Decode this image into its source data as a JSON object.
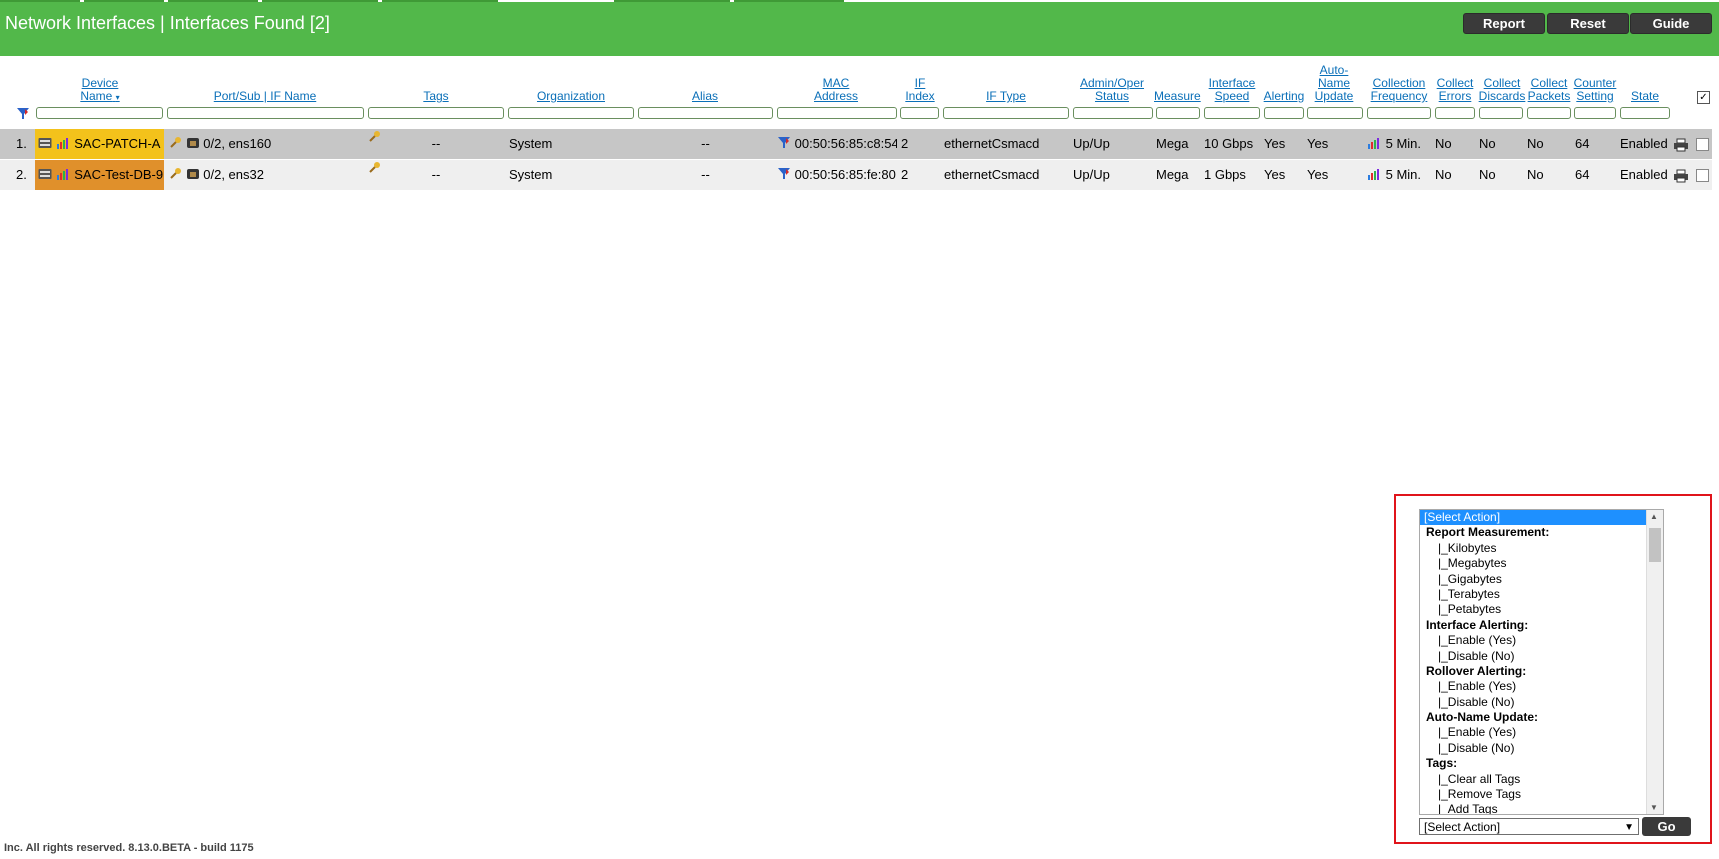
{
  "header": {
    "title": "Network Interfaces | Interfaces Found [2]",
    "buttons": {
      "report": "Report",
      "reset": "Reset",
      "guide": "Guide"
    }
  },
  "columns": {
    "device_name": [
      "Device",
      "Name"
    ],
    "port": "Port/Sub | IF Name",
    "tags": "Tags",
    "organization": "Organization",
    "alias": "Alias",
    "mac": [
      "MAC",
      "Address"
    ],
    "if_index": [
      "IF",
      "Index"
    ],
    "if_type": "IF Type",
    "admin_oper": [
      "Admin/Oper",
      "Status"
    ],
    "measure": "Measure",
    "speed": [
      "Interface",
      "Speed"
    ],
    "alerting": "Alerting",
    "auto_name": [
      "Auto-",
      "Name",
      "Update"
    ],
    "collection": [
      "Collection",
      "Frequency"
    ],
    "errors": [
      "Collect",
      "Errors"
    ],
    "discards": [
      "Collect",
      "Discards"
    ],
    "packets": [
      "Collect",
      "Packets"
    ],
    "counter": [
      "Counter",
      "Setting"
    ],
    "state": "State"
  },
  "rows": [
    {
      "num": "1.",
      "device": "SAC-PATCH-A",
      "device_color": "#f3c21b",
      "port": "0/2, ens160",
      "tags": "--",
      "organization": "System",
      "alias": "--",
      "mac": "00:50:56:85:c8:54",
      "if_index": "2",
      "if_type": "ethernetCsmacd",
      "status": "Up/Up",
      "measure": "Mega",
      "speed": "10 Gbps",
      "alerting": "Yes",
      "auto_name": "Yes",
      "frequency": "5 Min.",
      "errors": "No",
      "discards": "No",
      "packets": "No",
      "counter": "64",
      "state": "Enabled"
    },
    {
      "num": "2.",
      "device": "SAC-Test-DB-9",
      "device_color": "#e0902b",
      "port": "0/2, ens32",
      "tags": "--",
      "organization": "System",
      "alias": "--",
      "mac": "00:50:56:85:fe:80",
      "if_index": "2",
      "if_type": "ethernetCsmacd",
      "status": "Up/Up",
      "measure": "Mega",
      "speed": "1 Gbps",
      "alerting": "Yes",
      "auto_name": "Yes",
      "frequency": "5 Min.",
      "errors": "No",
      "discards": "No",
      "packets": "No",
      "counter": "64",
      "state": "Enabled"
    }
  ],
  "actions": {
    "options": [
      {
        "label": "[Select Action]",
        "kind": "sel"
      },
      {
        "label": "Report Measurement:",
        "kind": "grp"
      },
      {
        "label": "|_Kilobytes",
        "kind": "sub"
      },
      {
        "label": "|_Megabytes",
        "kind": "sub"
      },
      {
        "label": "|_Gigabytes",
        "kind": "sub"
      },
      {
        "label": "|_Terabytes",
        "kind": "sub"
      },
      {
        "label": "|_Petabytes",
        "kind": "sub"
      },
      {
        "label": "Interface Alerting:",
        "kind": "grp"
      },
      {
        "label": "|_Enable (Yes)",
        "kind": "sub"
      },
      {
        "label": "|_Disable (No)",
        "kind": "sub"
      },
      {
        "label": "Rollover Alerting:",
        "kind": "grp"
      },
      {
        "label": "|_Enable (Yes)",
        "kind": "sub"
      },
      {
        "label": "|_Disable (No)",
        "kind": "sub"
      },
      {
        "label": "Auto-Name Update:",
        "kind": "grp"
      },
      {
        "label": "|_Enable (Yes)",
        "kind": "sub"
      },
      {
        "label": "|_Disable (No)",
        "kind": "sub"
      },
      {
        "label": "Tags:",
        "kind": "grp"
      },
      {
        "label": "|_Clear all Tags",
        "kind": "sub"
      },
      {
        "label": "|_Remove Tags",
        "kind": "sub"
      },
      {
        "label": "|_Add Tags",
        "kind": "sub"
      }
    ],
    "select_value": "[Select Action]",
    "go_label": "Go"
  },
  "footer": {
    "text": "Inc. All rights reserved. 8.13.0.BETA - build 1175"
  }
}
